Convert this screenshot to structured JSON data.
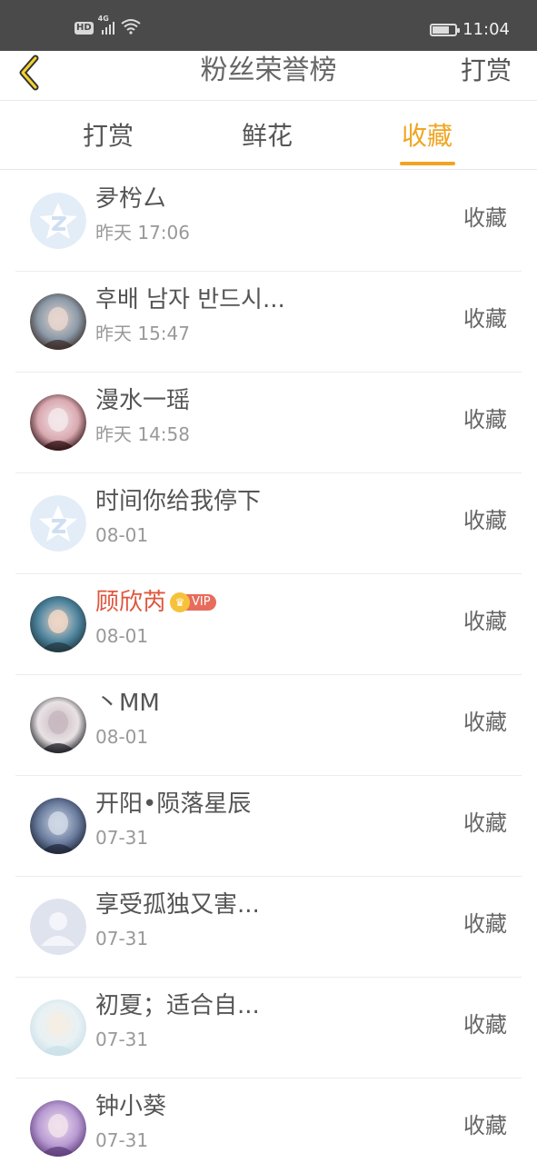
{
  "status_bar": {
    "hd": "HD",
    "network": "4G",
    "time": "11:04",
    "battery_level": 0.75
  },
  "nav": {
    "back_icon": "chevron-left-icon",
    "title": "粉丝荣誉榜",
    "action": "打赏"
  },
  "tabs": [
    {
      "label": "打赏",
      "active": false
    },
    {
      "label": "鲜花",
      "active": false
    },
    {
      "label": "收藏",
      "active": true
    }
  ],
  "colors": {
    "accent": "#f0a522",
    "vip_name": "#e0553c",
    "vip_tag": "#e76c5c"
  },
  "list": [
    {
      "name": "夛枍厶",
      "time": "昨天 17:06",
      "action": "收藏",
      "avatar": "default-star-avatar",
      "vip": false
    },
    {
      "name": "후배 남자 반드시...",
      "time": "昨天 15:47",
      "action": "收藏",
      "avatar": "photo-avatar",
      "vip": false
    },
    {
      "name": "漫水一瑶",
      "time": "昨天 14:58",
      "action": "收藏",
      "avatar": "photo-avatar",
      "vip": false
    },
    {
      "name": "时间你给我停下",
      "time": "08-01",
      "action": "收藏",
      "avatar": "default-star-avatar",
      "vip": false
    },
    {
      "name": "顾欣芮",
      "time": "08-01",
      "action": "收藏",
      "avatar": "photo-avatar",
      "vip": true,
      "vip_label": "VIP"
    },
    {
      "name": "丶MM",
      "time": "08-01",
      "action": "收藏",
      "avatar": "photo-avatar",
      "vip": false
    },
    {
      "name": "开阳•陨落星辰",
      "time": "07-31",
      "action": "收藏",
      "avatar": "photo-avatar",
      "vip": false
    },
    {
      "name": "享受孤独又害...",
      "time": "07-31",
      "action": "收藏",
      "avatar": "default-person-avatar",
      "vip": false
    },
    {
      "name": "初夏；适合自...",
      "time": "07-31",
      "action": "收藏",
      "avatar": "photo-avatar",
      "vip": false
    },
    {
      "name": "钟小葵",
      "time": "07-31",
      "action": "收藏",
      "avatar": "photo-avatar",
      "vip": false
    }
  ]
}
